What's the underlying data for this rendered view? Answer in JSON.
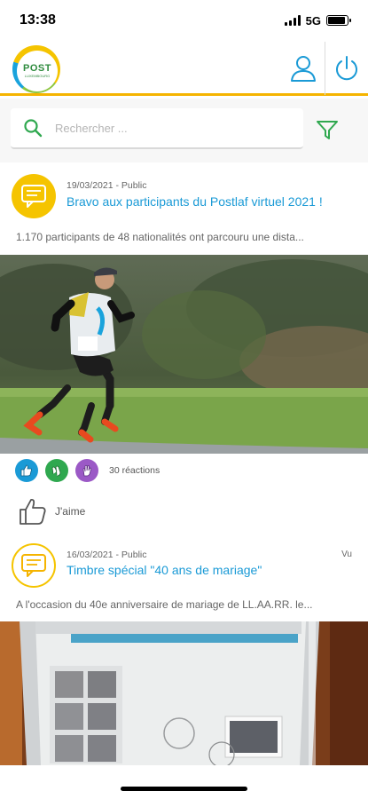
{
  "status": {
    "time": "13:38",
    "network": "5G",
    "battery_level": 0.9
  },
  "header": {
    "logo_text": "POST",
    "logo_sub": "LUXEMBOURG",
    "profile_icon": "user-icon",
    "power_icon": "power-icon"
  },
  "search": {
    "placeholder": "Rechercher ...",
    "icon": "search-icon",
    "filter_icon": "filter-icon"
  },
  "posts": [
    {
      "meta": "19/03/2021 - Public",
      "title": "Bravo aux participants du Postlaf virtuel 2021 !",
      "excerpt": "1.170 participants de 48 nationalités ont parcouru une dista...",
      "seen": "",
      "reactions": {
        "count_label": "30 réactions",
        "icons": [
          "thumbs-up-icon",
          "clap-icon",
          "hand-icon"
        ]
      },
      "like_label": "J'aime"
    },
    {
      "meta": "16/03/2021 - Public",
      "title": "Timbre spécial \"40 ans de mariage\"",
      "excerpt": "A l'occasion du 40e anniversaire de mariage de LL.AA.RR. le...",
      "seen": "Vu"
    }
  ],
  "colors": {
    "accent_yellow": "#f5b400",
    "link_blue": "#1a9ad6",
    "search_green": "#2fa84f"
  }
}
